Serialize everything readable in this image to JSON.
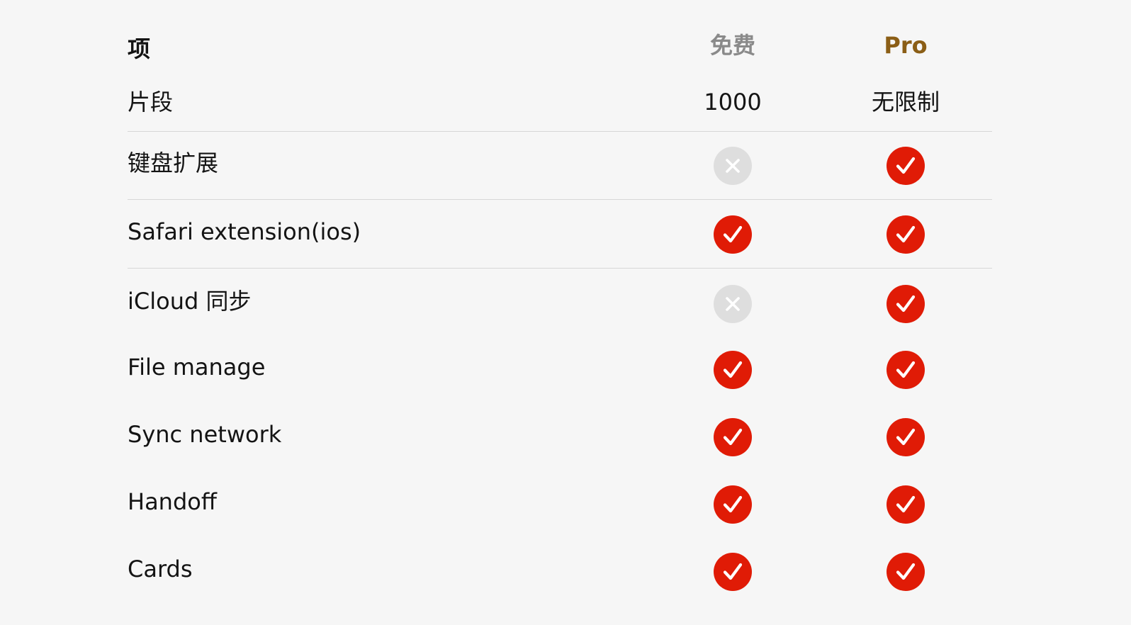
{
  "header": {
    "label": "项",
    "free": "免费",
    "pro": "Pro"
  },
  "segments_row": {
    "label": "片段",
    "free": "1000",
    "pro": "无限制"
  },
  "features": [
    {
      "label": "键盘扩展",
      "free": "x",
      "pro": "check"
    },
    {
      "label": "Safari extension(ios)",
      "free": "check",
      "pro": "check"
    },
    {
      "label": "iCloud 同步",
      "free": "x",
      "pro": "check"
    },
    {
      "label": "File manage",
      "free": "check",
      "pro": "check"
    },
    {
      "label": "Sync network",
      "free": "check",
      "pro": "check"
    },
    {
      "label": "Handoff",
      "free": "check",
      "pro": "check"
    },
    {
      "label": "Cards",
      "free": "check",
      "pro": "check"
    }
  ],
  "colors": {
    "check_bg": "#e01b06",
    "x_bg": "#dedede",
    "pro_header": "#8b5e16",
    "free_header": "#8a8a8a"
  }
}
